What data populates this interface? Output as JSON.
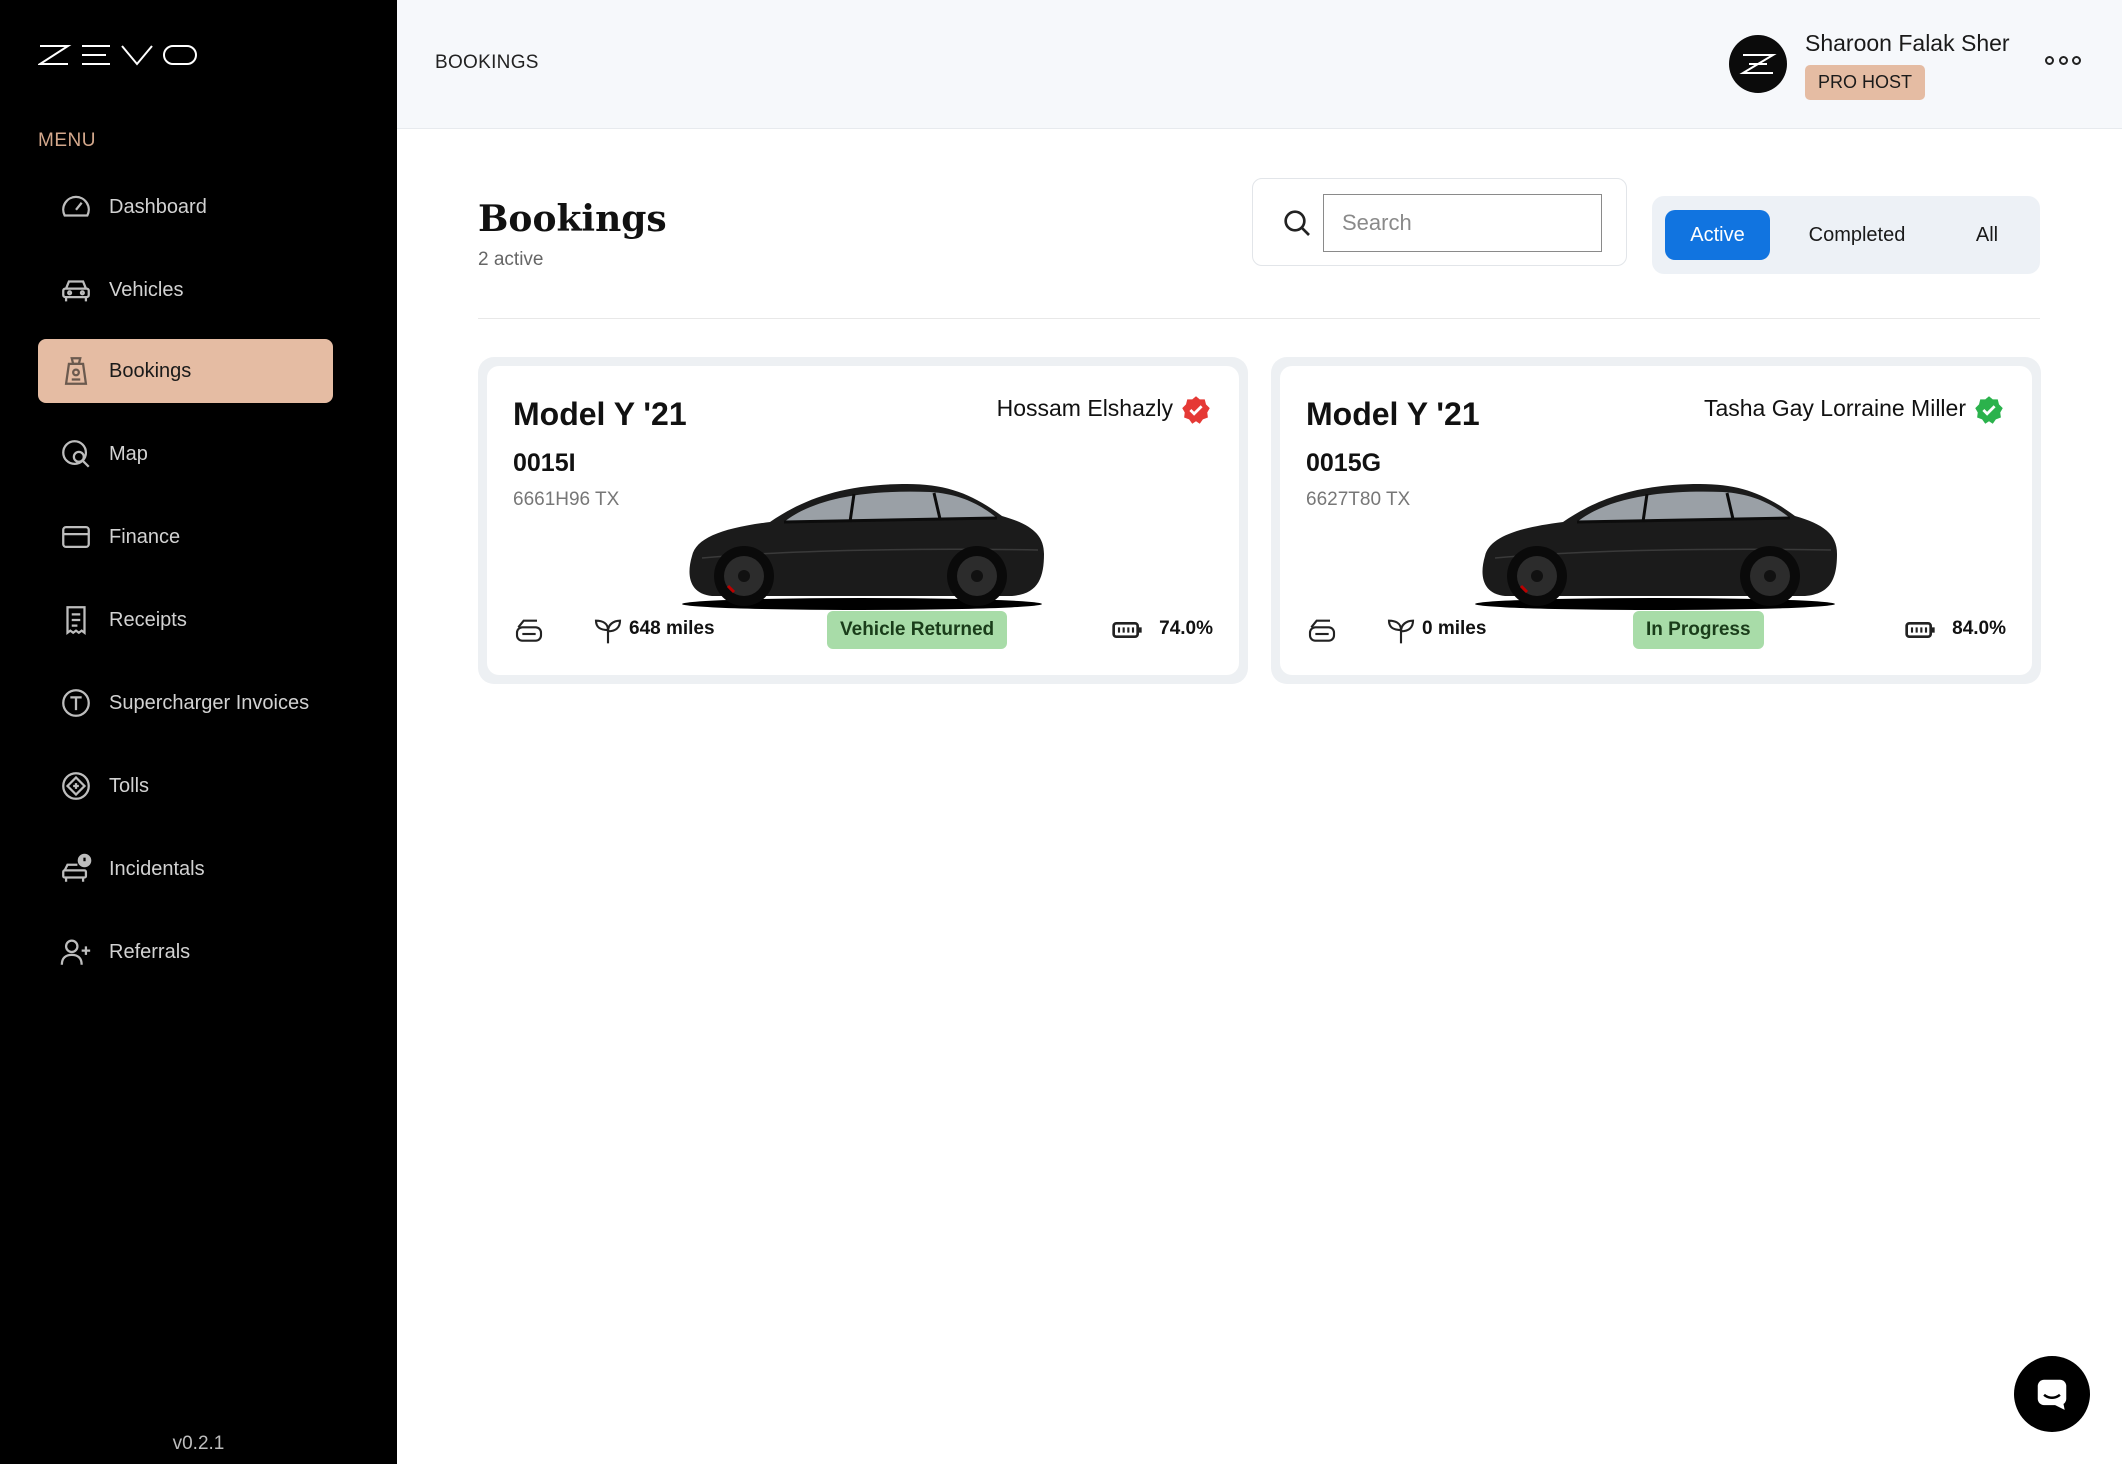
{
  "app": {
    "logo_text": "ZEVO",
    "version": "v0.2.1"
  },
  "sidebar": {
    "menu_label": "MENU",
    "items": [
      {
        "label": "Dashboard",
        "icon": "speedometer-icon"
      },
      {
        "label": "Vehicles",
        "icon": "car-icon"
      },
      {
        "label": "Bookings",
        "icon": "booking-tag-icon",
        "active": true
      },
      {
        "label": "Map",
        "icon": "map-search-icon"
      },
      {
        "label": "Finance",
        "icon": "wallet-icon"
      },
      {
        "label": "Receipts",
        "icon": "receipt-icon"
      },
      {
        "label": "Supercharger Invoices",
        "icon": "supercharger-icon"
      },
      {
        "label": "Tolls",
        "icon": "toll-road-icon"
      },
      {
        "label": "Incidentals",
        "icon": "car-alert-icon"
      },
      {
        "label": "Referrals",
        "icon": "user-add-icon"
      }
    ]
  },
  "header": {
    "breadcrumb": "BOOKINGS",
    "user_name": "Sharoon Falak Sher",
    "user_badge": "PRO HOST"
  },
  "main": {
    "title": "Bookings",
    "subtitle": "2 active",
    "search": {
      "placeholder": "Search",
      "value": ""
    },
    "tabs": [
      {
        "label": "Active",
        "active": true
      },
      {
        "label": "Completed",
        "active": false
      },
      {
        "label": "All",
        "active": false
      }
    ],
    "bookings": [
      {
        "model": "Model Y '21",
        "code": "0015I",
        "plate": "6661H96 TX",
        "guest": "Hossam Elshazly",
        "verify_color": "#e53935",
        "miles": "648 miles",
        "status": "Vehicle Returned",
        "battery": "74.0%"
      },
      {
        "model": "Model Y '21",
        "code": "0015G",
        "plate": "6627T80 TX",
        "guest": "Tasha Gay Lorraine Miller",
        "verify_color": "#2bb24c",
        "miles": "0 miles",
        "status": "In Progress",
        "battery": "84.0%"
      }
    ]
  },
  "colors": {
    "accent": "#e5bca3",
    "primary": "#1174e0",
    "status_green": "#a8dca8"
  }
}
